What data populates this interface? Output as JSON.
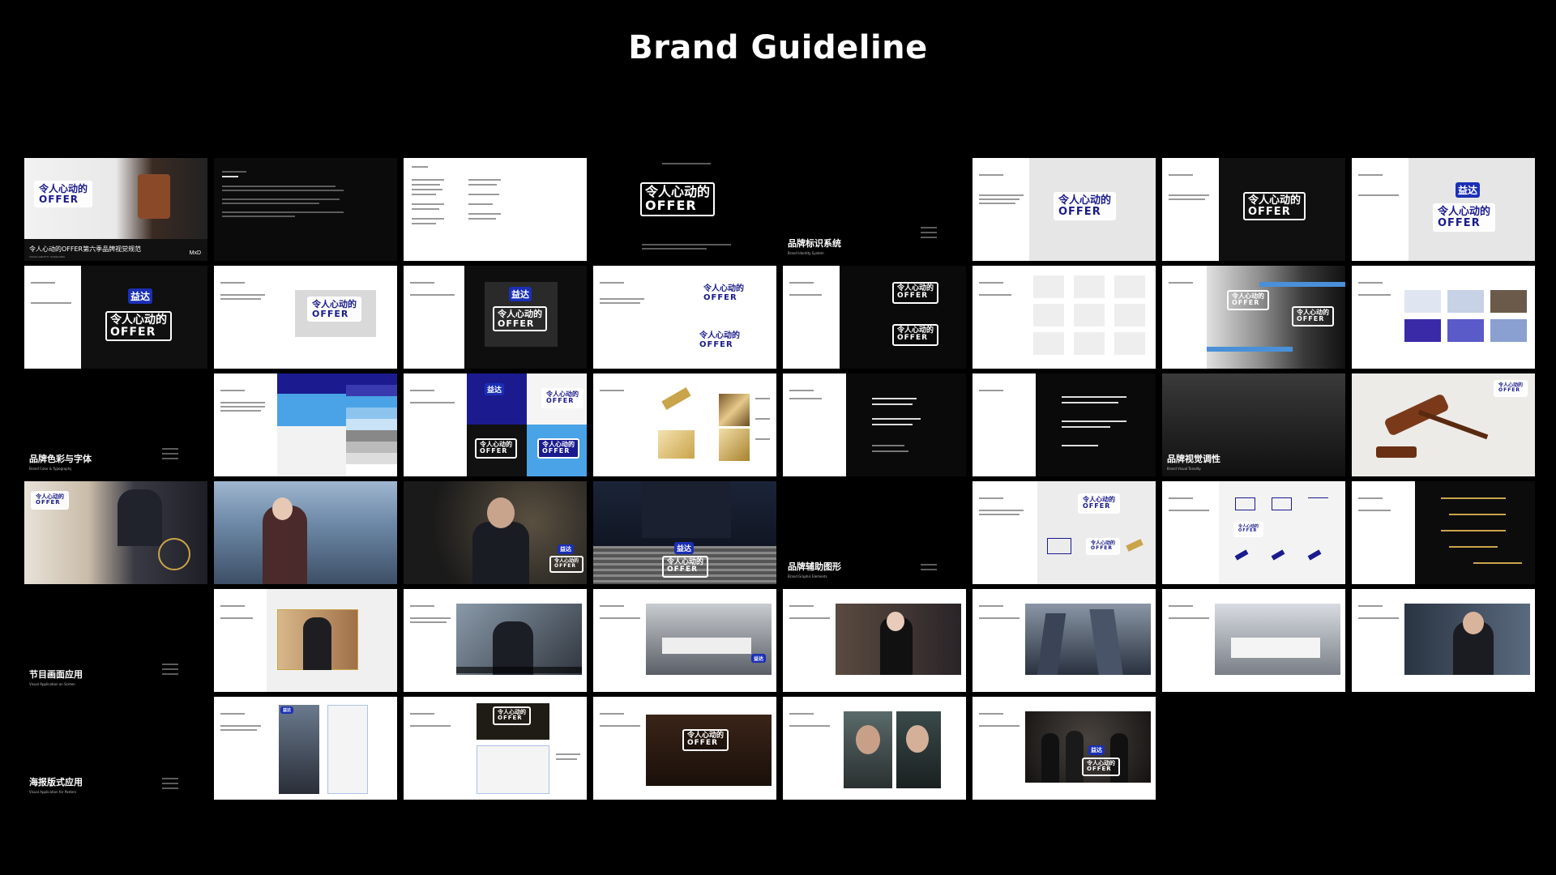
{
  "page": {
    "title": "Brand Guideline"
  },
  "brand": {
    "logo_line1": "令人心动的",
    "logo_line2": "OFFER",
    "sponsor": "益达",
    "agency": "MxD"
  },
  "cover": {
    "title": "令人心动的OFFER第六季品牌视觉规范",
    "subtitle": "VISUAL IDENTITY GUIDELINES"
  },
  "sections": [
    {
      "title": "品牌标识系统",
      "subtitle": "Brand Identity System"
    },
    {
      "title": "品牌色彩与字体",
      "subtitle": "Brand Color & Typography"
    },
    {
      "title": "品牌视觉调性",
      "subtitle": "Brand Visual Tonality"
    },
    {
      "title": "品牌辅助图形",
      "subtitle": "Brand Graphic Elements"
    },
    {
      "title": "节目画面应用",
      "subtitle": "Visual Application on Screen"
    },
    {
      "title": "海报版式应用",
      "subtitle": "Visual Application for Posters"
    }
  ],
  "colors": {
    "background": "#000000",
    "navy": "#1b1b8f",
    "royal_blue": "#1b2fb5",
    "sky_blue": "#4aa3e6",
    "gold": "#c9a44a",
    "light_gray": "#e5e5e5"
  }
}
